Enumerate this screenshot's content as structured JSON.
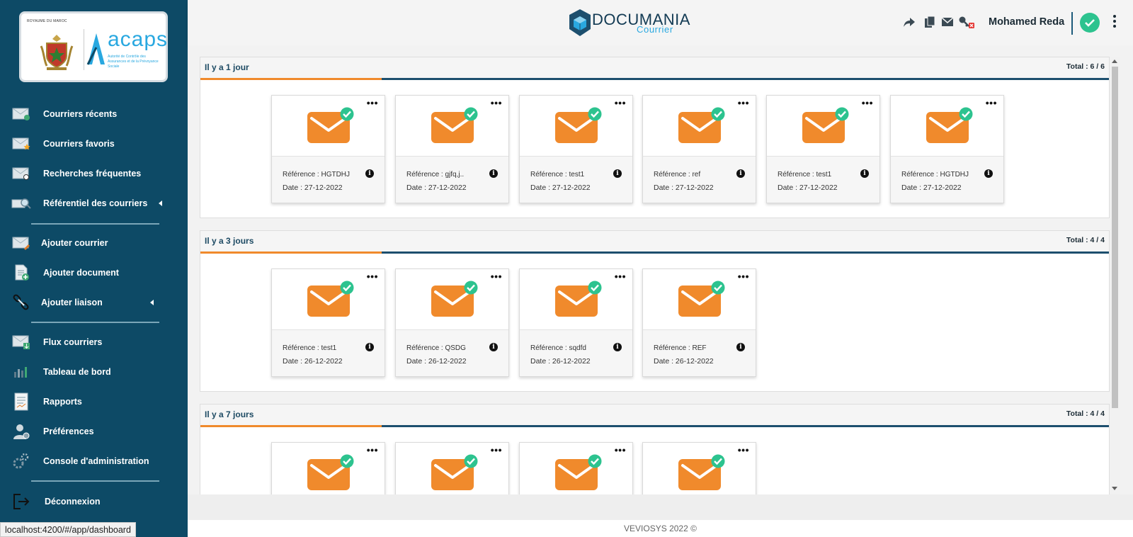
{
  "sidebar": {
    "logo": {
      "kingdom_text": "ROYAUME DU MAROC",
      "brand": "acaps",
      "subtitle": "Autorité de Contrôle des Assurances et de la Prévoyance Sociale"
    },
    "items": [
      {
        "label": "Courriers récents",
        "icon": "envelope-clock-icon"
      },
      {
        "label": "Courriers favoris",
        "icon": "envelope-star-icon"
      },
      {
        "label": "Recherches fréquentes",
        "icon": "envelope-search-icon"
      },
      {
        "label": "Référentiel des courriers",
        "icon": "envelope-magnifier-icon",
        "has_submenu": true
      },
      {
        "label": "Ajouter courrier",
        "icon": "envelope-pencil-icon"
      },
      {
        "label": "Ajouter document",
        "icon": "document-add-icon"
      },
      {
        "label": "Ajouter liaison",
        "icon": "link-icon",
        "has_submenu": true
      },
      {
        "label": "Flux courriers",
        "icon": "envelope-download-icon"
      },
      {
        "label": "Tableau de bord",
        "icon": "bar-chart-icon"
      },
      {
        "label": "Rapports",
        "icon": "report-icon"
      },
      {
        "label": "Préférences",
        "icon": "user-settings-icon"
      },
      {
        "label": "Console d'administration",
        "icon": "gears-icon"
      },
      {
        "label": "Déconnexion",
        "icon": "logout-icon"
      }
    ]
  },
  "status_bar": {
    "url": "localhost:4200/#/app/dashboard"
  },
  "header": {
    "brand_name": "DOCUMANIA",
    "brand_sub": "Courrier",
    "icons": [
      "share-icon",
      "copy-icon",
      "mail-icon",
      "key-revoke-icon"
    ],
    "user_name": "Mohamed Reda",
    "status_icon": "check-circle-icon"
  },
  "colors": {
    "sidebar_bg": "#0d4a66",
    "accent_orange": "#f08a2c",
    "accent_blue": "#1d4f6e",
    "check_green": "#2dc38f"
  },
  "sections": [
    {
      "title": "Il y a 1 jour",
      "total": "Total : 6 / 6",
      "cards": [
        {
          "reference": "Référence : HGTDHJ",
          "date": "Date : 27-12-2022"
        },
        {
          "reference": "Référence : gjfq,j..",
          "date": "Date : 27-12-2022"
        },
        {
          "reference": "Référence : test1",
          "date": "Date : 27-12-2022"
        },
        {
          "reference": "Référence : ref",
          "date": "Date : 27-12-2022"
        },
        {
          "reference": "Référence : test1",
          "date": "Date : 27-12-2022"
        },
        {
          "reference": "Référence : HGTDHJ",
          "date": "Date : 27-12-2022"
        }
      ]
    },
    {
      "title": "Il y a 3 jours",
      "total": "Total : 4 / 4",
      "cards": [
        {
          "reference": "Référence : test1",
          "date": "Date : 26-12-2022"
        },
        {
          "reference": "Référence : QSDG",
          "date": "Date : 26-12-2022"
        },
        {
          "reference": "Référence : sqdfd",
          "date": "Date : 26-12-2022"
        },
        {
          "reference": "Référence : REF",
          "date": "Date : 26-12-2022"
        }
      ]
    },
    {
      "title": "Il y a 7 jours",
      "total": "Total : 4 / 4",
      "cards": [
        {
          "reference": "",
          "date": ""
        },
        {
          "reference": "",
          "date": ""
        },
        {
          "reference": "",
          "date": ""
        },
        {
          "reference": "",
          "date": ""
        }
      ]
    }
  ],
  "card_ui": {
    "menu_icon": "ellipsis-icon",
    "info_icon": "info-icon",
    "mail_icon": "envelope-icon",
    "badge_icon": "check-badge-icon"
  },
  "footer": {
    "text": "VEVIOSYS 2022 ©"
  }
}
